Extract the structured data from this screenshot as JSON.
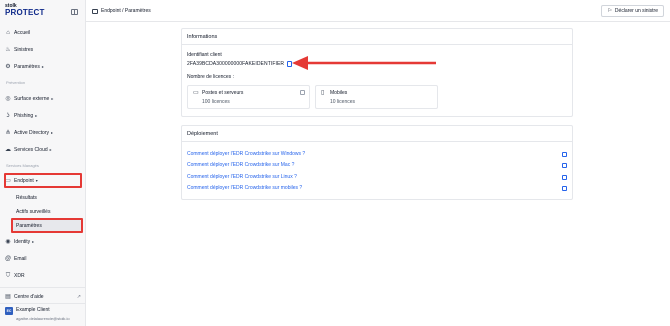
{
  "brand": {
    "line1": "stolk",
    "line2": "PROTECT"
  },
  "sidebar": {
    "items": [
      {
        "label": "Accueil",
        "icon": "home-icon"
      },
      {
        "label": "Sinistres",
        "icon": "flame-icon"
      },
      {
        "label": "Paramètres",
        "icon": "gear-icon"
      }
    ],
    "section_prevention": "Prévention",
    "prevention_items": [
      {
        "label": "Surface externe",
        "icon": "globe-icon"
      },
      {
        "label": "Phishing",
        "icon": "hook-icon"
      },
      {
        "label": "Active Directory",
        "icon": "network-icon"
      },
      {
        "label": "Services Cloud",
        "icon": "cloud-icon"
      }
    ],
    "section_managed": "Services Managés",
    "endpoint": {
      "label": "Endpoint",
      "icon": "laptop-icon"
    },
    "endpoint_sub": [
      "Résultats",
      "Actifs surveillés",
      "Paramètres"
    ],
    "managed_items": [
      {
        "label": "Identity",
        "icon": "fingerprint-icon"
      },
      {
        "label": "Email",
        "icon": "at-icon"
      },
      {
        "label": "XDR",
        "icon": "shield-icon"
      }
    ],
    "help": {
      "label": "Centre d'aide"
    },
    "user": {
      "initials": "EC",
      "name": "Example Client",
      "email": "agathe.delalaurencie@stoik.io"
    }
  },
  "topbar": {
    "breadcrumb": "Endpoint / Paramètres",
    "declare_label": "Déclarer un sinistre"
  },
  "info_card": {
    "title": "Informations",
    "client_id_label": "Identifiant client",
    "client_id_value": "2FA39BCDA300000000FAKEIDENTIFIER",
    "licences_label": "Nombre de licences :",
    "licences": [
      {
        "title": "Postes et serveurs",
        "count": "100 licences"
      },
      {
        "title": "Mobiles",
        "count": "10 licences"
      }
    ]
  },
  "deploy_card": {
    "title": "Déploiement",
    "links": [
      "Comment déployer l'EDR Crowdstrike sur Windows ?",
      "Comment déployer l'EDR Crowdstrike sur Mac ?",
      "Comment déployer l'EDR Crowdstrike sur Linux ?",
      "Comment déployer l'EDR Crowdstrike sur mobiles ?"
    ]
  },
  "colors": {
    "accent": "#2563eb",
    "highlight": "#e53935",
    "brand": "#0f2a8a"
  }
}
